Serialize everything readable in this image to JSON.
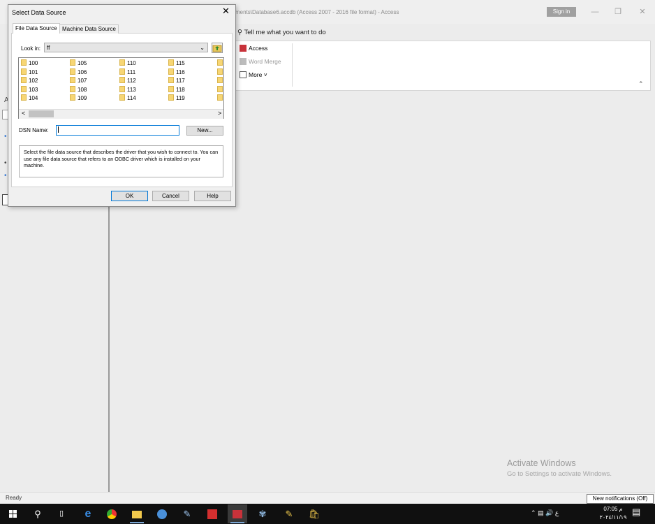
{
  "app": {
    "title": "ments\\Database6.accdb (Access 2007 - 2016 file format)  -  Access",
    "sign_in": "Sign in",
    "tell_me": "Tell me what you want to do",
    "ribbon": {
      "access": "Access",
      "word_merge": "Word Merge",
      "more": "More ˅"
    },
    "status": "Ready",
    "left_fragments": [
      "A",
      "S",
      "•",
      "•",
      "•",
      "•"
    ]
  },
  "dialog": {
    "title": "Select Data Source",
    "tabs": [
      "File Data Source",
      "Machine Data Source"
    ],
    "look_in_label": "Look in:",
    "look_in_value": "ff",
    "folders": [
      [
        "100",
        "101",
        "102",
        "103",
        "104"
      ],
      [
        "105",
        "106",
        "107",
        "108",
        "109"
      ],
      [
        "110",
        "111",
        "112",
        "113",
        "114"
      ],
      [
        "115",
        "116",
        "117",
        "118",
        "119"
      ]
    ],
    "dsn_label": "DSN Name:",
    "dsn_value": "",
    "new_button": "New...",
    "description": "Select the file data source that describes the driver that you wish to connect to. You can use any file data source that refers to an ODBC driver which is installed on your machine.",
    "ok": "OK",
    "cancel": "Cancel",
    "help": "Help"
  },
  "watermark": {
    "line1": "Activate Windows",
    "line2": "Go to Settings to activate Windows."
  },
  "notification": "New notifications (Off)",
  "taskbar": {
    "time": "07:05 م",
    "date": "٢٠٢٤/١١/١٩",
    "lang": "ع"
  }
}
